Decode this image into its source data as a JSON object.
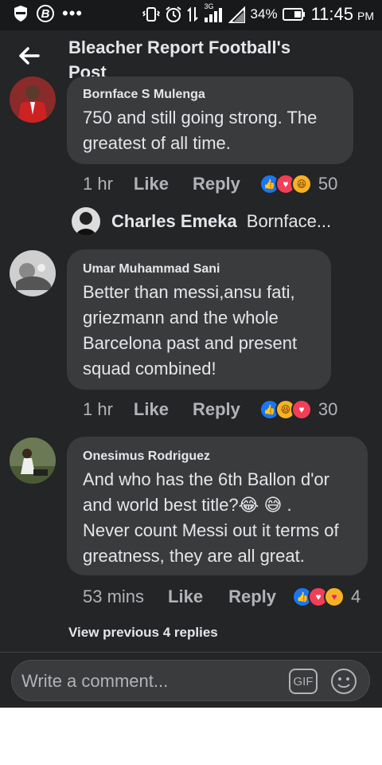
{
  "status_bar": {
    "battery_percent": "34%",
    "network": "3G",
    "time": "11:45",
    "ampm": "PM",
    "icons": [
      "shield-icon",
      "b-app-icon",
      "more-dots-icon",
      "vibrate-icon",
      "alarm-icon",
      "data-arrows-icon",
      "signal-icon",
      "signal-empty-icon",
      "battery-icon"
    ]
  },
  "header": {
    "title": "Bleacher Report Football's Post",
    "back_icon": "arrow-left-icon"
  },
  "comments": [
    {
      "author": "Bornface S Mulenga",
      "text": "750 and still going strong. The greatest of all time.",
      "time": "1 hr",
      "like_label": "Like",
      "reply_label": "Reply",
      "reactions": [
        "like",
        "love",
        "haha"
      ],
      "reaction_count": "50"
    },
    {
      "author": "Umar Muhammad Sani",
      "text": "Better than messi,ansu fati, griezmann and the whole Barcelona past and present squad  combined!",
      "time": "1 hr",
      "like_label": "Like",
      "reply_label": "Reply",
      "reactions": [
        "like",
        "haha",
        "love"
      ],
      "reaction_count": "30"
    },
    {
      "author": "Onesimus Rodriguez",
      "text_line1": "And who has the 6th Ballon d'or",
      "text_line2": "and world best title?",
      "text_emojis": "😂 😅 .",
      "text_rest": "Never count Messi out it terms of greatness, they are all great.",
      "time": "53 mins",
      "like_label": "Like",
      "reply_label": "Reply",
      "reactions": [
        "like",
        "love",
        "care"
      ],
      "reaction_count": "4"
    }
  ],
  "reply_preview": {
    "author": "Charles Emeka",
    "snippet": "Bornface..."
  },
  "view_previous": "View previous 4 replies",
  "composer": {
    "placeholder": "Write a comment...",
    "gif_label": "GIF"
  },
  "colors": {
    "background": "#242526",
    "bubble": "#3a3b3c",
    "text": "#e4e6eb",
    "muted": "#b0b3b8",
    "like_blue": "#1877f2",
    "love_red": "#f33e58",
    "haha_yellow": "#f7b125"
  }
}
